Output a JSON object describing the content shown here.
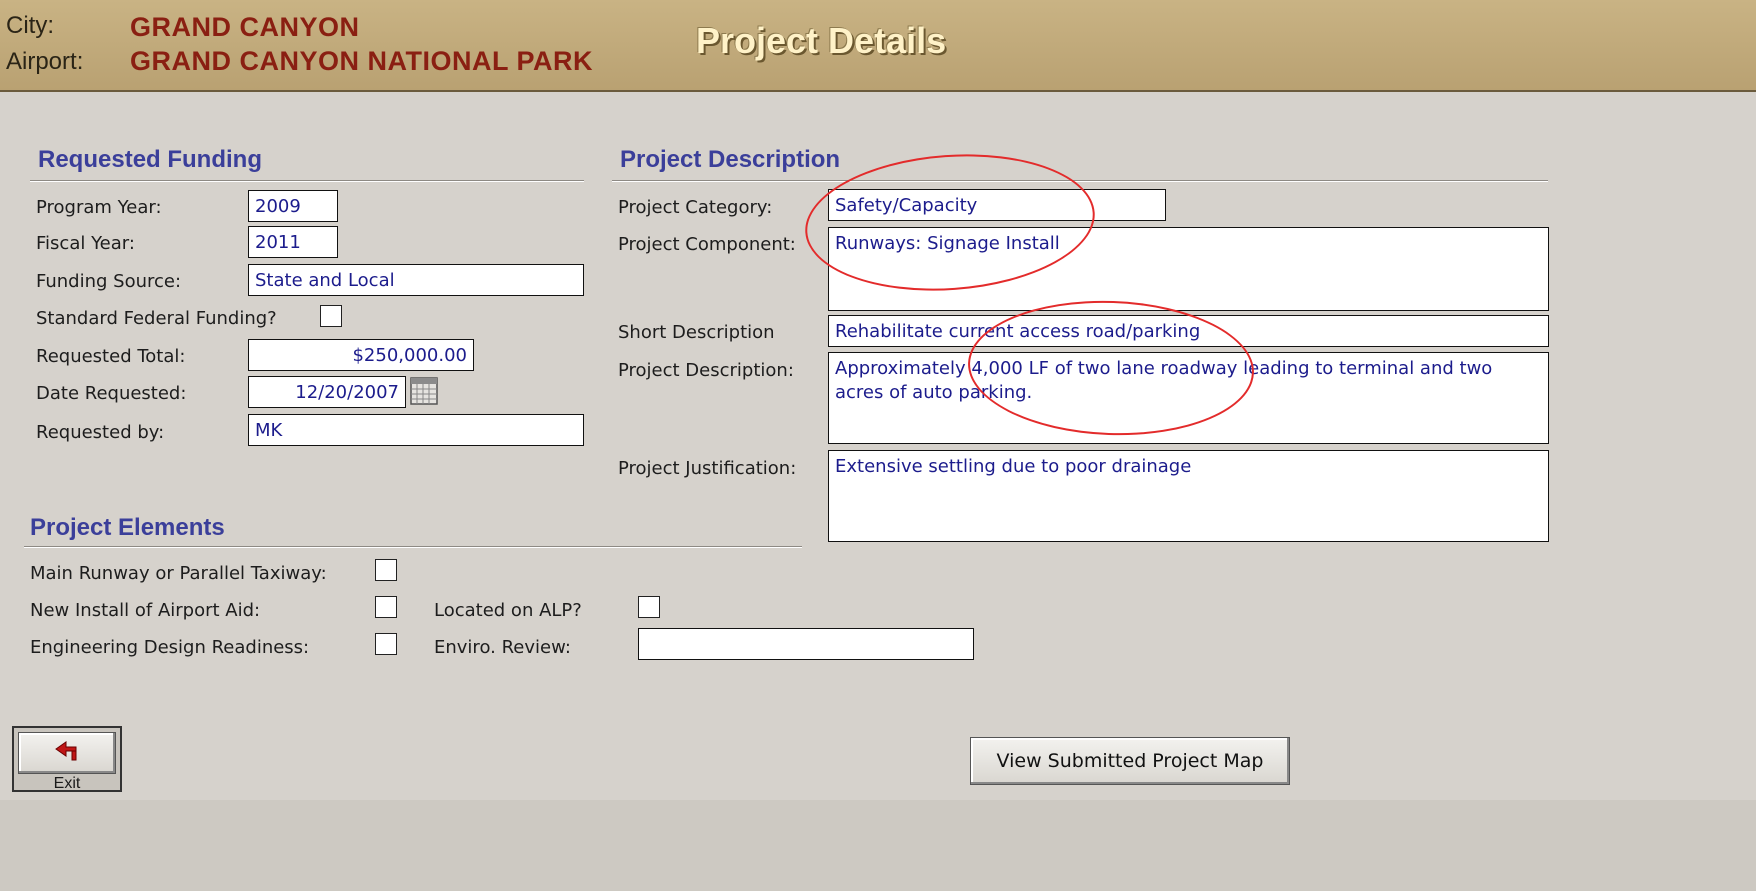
{
  "header": {
    "city_label": "City:",
    "city_value": "GRAND CANYON",
    "airport_label": "Airport:",
    "airport_value": "GRAND CANYON NATIONAL PARK",
    "title": "Project Details"
  },
  "requested_funding": {
    "title": "Requested Funding",
    "program_year_label": "Program Year:",
    "program_year": "2009",
    "fiscal_year_label": "Fiscal Year:",
    "fiscal_year": "2011",
    "funding_source_label": "Funding Source:",
    "funding_source": "State and Local",
    "standard_federal_label": "Standard Federal Funding?",
    "standard_federal_checked": false,
    "requested_total_label": "Requested Total:",
    "requested_total": "$250,000.00",
    "date_requested_label": "Date Requested:",
    "date_requested": "12/20/2007",
    "requested_by_label": "Requested by:",
    "requested_by": "MK"
  },
  "project_description": {
    "title": "Project Description",
    "category_label": "Project Category:",
    "category": "Safety/Capacity",
    "component_label": "Project Component:",
    "component": "Runways: Signage Install",
    "short_description_label": "Short Description",
    "short_description": "Rehabilitate current access road/parking",
    "description_label": "Project Description:",
    "description": "Approximately 4,000 LF of two lane roadway leading to terminal and two acres of auto parking.",
    "justification_label": "Project Justification:",
    "justification": "Extensive settling due to poor drainage"
  },
  "project_elements": {
    "title": "Project Elements",
    "main_runway_label": "Main Runway or Parallel Taxiway:",
    "new_install_label": "New Install of Airport Aid:",
    "engineering_label": "Engineering Design Readiness:",
    "located_alp_label": "Located on ALP?",
    "enviro_label": "Enviro. Review:",
    "enviro_value": ""
  },
  "buttons": {
    "exit_label": "Exit",
    "view_map_label": "View Submitted Project Map"
  },
  "colors": {
    "header_bg": "#c2ab7c",
    "section_title": "#3b3f9a",
    "field_text": "#1c1c8c",
    "annotation_red": "#e32b2b"
  },
  "icons": {
    "exit": "exit-arrow-icon",
    "date_picker": "calendar-icon"
  }
}
